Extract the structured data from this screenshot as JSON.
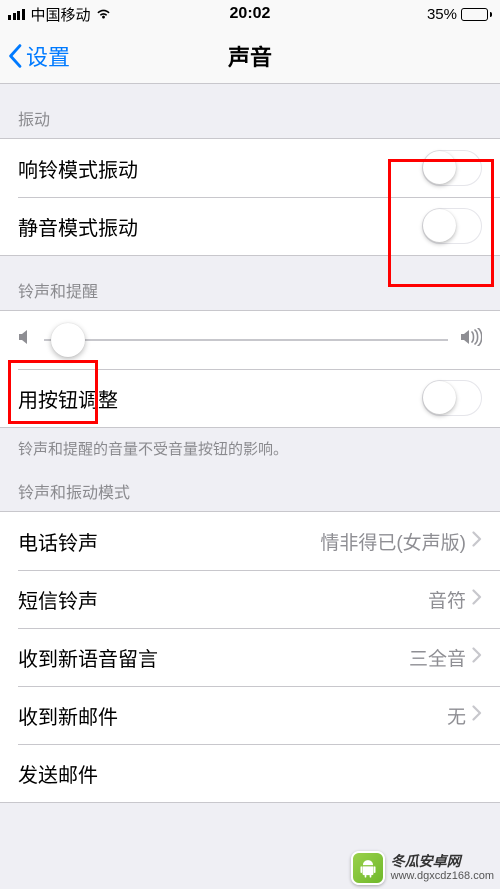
{
  "status": {
    "carrier": "中国移动",
    "time": "20:02",
    "battery_pct": "35%",
    "battery_fill_pct": 35
  },
  "nav": {
    "back_label": "设置",
    "title": "声音"
  },
  "sections": {
    "vibration": {
      "header": "振动",
      "rows": {
        "ring_vibrate": "响铃模式振动",
        "silent_vibrate": "静音模式振动"
      }
    },
    "ringer": {
      "header": "铃声和提醒",
      "slider_value": 6,
      "change_with_buttons": "用按钮调整",
      "footer": "铃声和提醒的音量不受音量按钮的影响。"
    },
    "sounds": {
      "header": "铃声和振动模式",
      "rows": {
        "ringtone": {
          "label": "电话铃声",
          "value": "情非得已(女声版)"
        },
        "text_tone": {
          "label": "短信铃声",
          "value": "音符"
        },
        "new_voicemail": {
          "label": "收到新语音留言",
          "value": "三全音"
        },
        "new_mail": {
          "label": "收到新邮件",
          "value": "无"
        },
        "sent_mail": {
          "label": "发送邮件",
          "value": ""
        }
      }
    }
  },
  "watermark": {
    "name": "冬瓜安卓网",
    "url": "www.dgxcdz168.com"
  }
}
